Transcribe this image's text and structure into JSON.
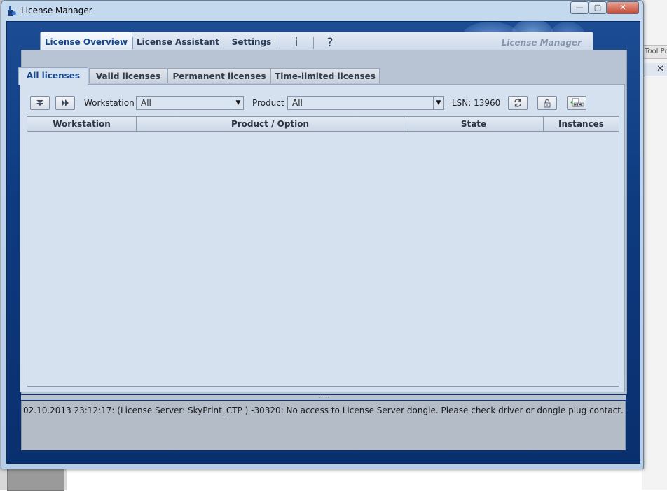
{
  "background": {
    "right_strip_label": "Tool Pr",
    "right_close_glyph": "✕"
  },
  "window": {
    "title": "License Manager",
    "controls": {
      "minimize": "—",
      "maximize": "▢",
      "close": "✕"
    }
  },
  "nav": {
    "items": [
      "License Overview",
      "License Assistant",
      "Settings"
    ],
    "info_glyph": "i",
    "help_glyph": "?",
    "brand": "License Manager"
  },
  "tabs": [
    "All licenses",
    "Valid licenses",
    "Permanent licenses",
    "Time-limited licenses"
  ],
  "toolbar": {
    "workstation_label": "Workstation",
    "workstation_value": "All",
    "product_label": "Product",
    "product_value": "All",
    "lsn": "LSN: 13960"
  },
  "table": {
    "columns": [
      "Workstation",
      "Product / Option",
      "State",
      "Instances"
    ],
    "rows": []
  },
  "log": {
    "message": "02.10.2013 23:12:17: (License Server: SkyPrint_CTP )  -30320: No access to License Server dongle. Please check driver or dongle plug contact."
  }
}
